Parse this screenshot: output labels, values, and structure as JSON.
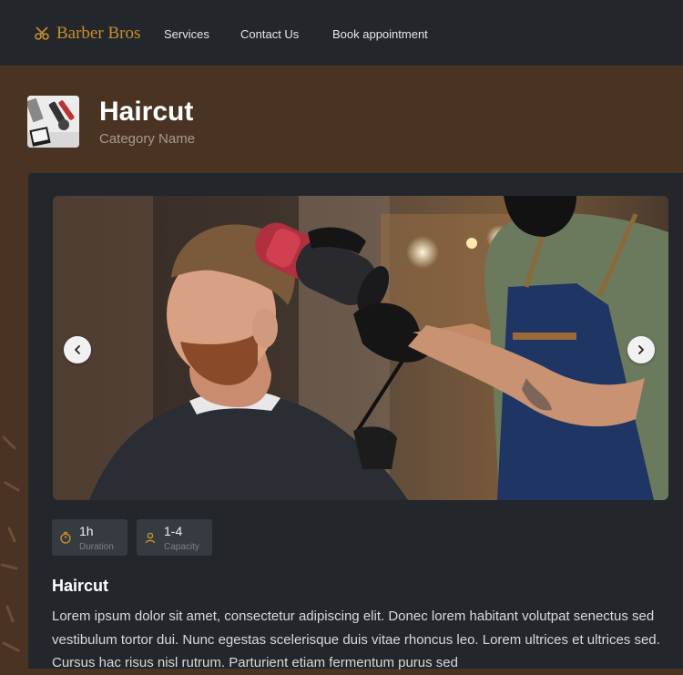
{
  "nav": {
    "brand": "Barber Bros",
    "links": [
      "Services",
      "Contact Us",
      "Book appointment"
    ]
  },
  "header": {
    "title": "Haircut",
    "category": "Category Name"
  },
  "stats": [
    {
      "value": "1h",
      "label": "Duration",
      "icon": "timer-icon"
    },
    {
      "value": "1-4",
      "label": "Capacity",
      "icon": "person-icon"
    }
  ],
  "service": {
    "title": "Haircut",
    "description": "Lorem ipsum dolor sit amet, consectetur adipiscing elit. Donec lorem habitant volutpat senectus sed vestibulum tortor dui. Nunc egestas scelerisque duis vitae rhoncus leo. Lorem ultrices et ultrices sed. Cursus hac risus nisl rutrum. Parturient etiam fermentum purus sed"
  },
  "colors": {
    "brand": "#c98d2e",
    "nav_bg": "#23272b",
    "header_bg": "#4a3322",
    "card_bg": "#23272b"
  }
}
